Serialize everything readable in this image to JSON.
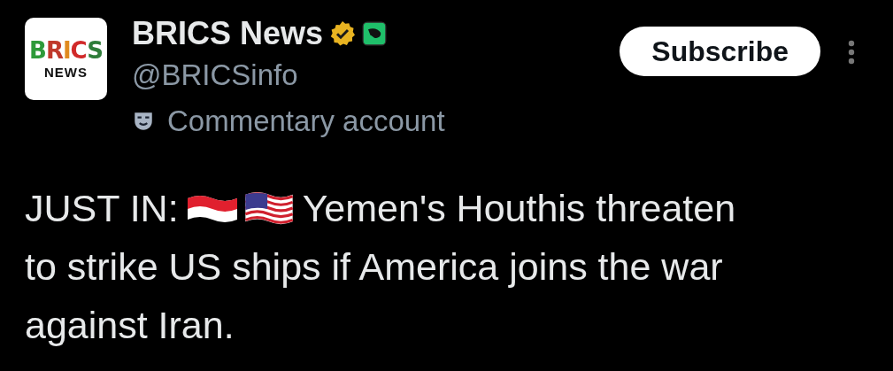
{
  "author": {
    "avatar": {
      "logo_text": "BRICS",
      "logo_subtext": "NEWS"
    },
    "name": "BRICS News",
    "verified": true,
    "affiliate_badge": true,
    "handle": "@BRICSinfo",
    "account_label": "Commentary account"
  },
  "subscribe_button": "Subscribe",
  "post": {
    "lead": "JUST IN:",
    "first_line": "Yemen's Houthis threaten",
    "rest": "to strike US ships if America joins the war against Iran."
  }
}
